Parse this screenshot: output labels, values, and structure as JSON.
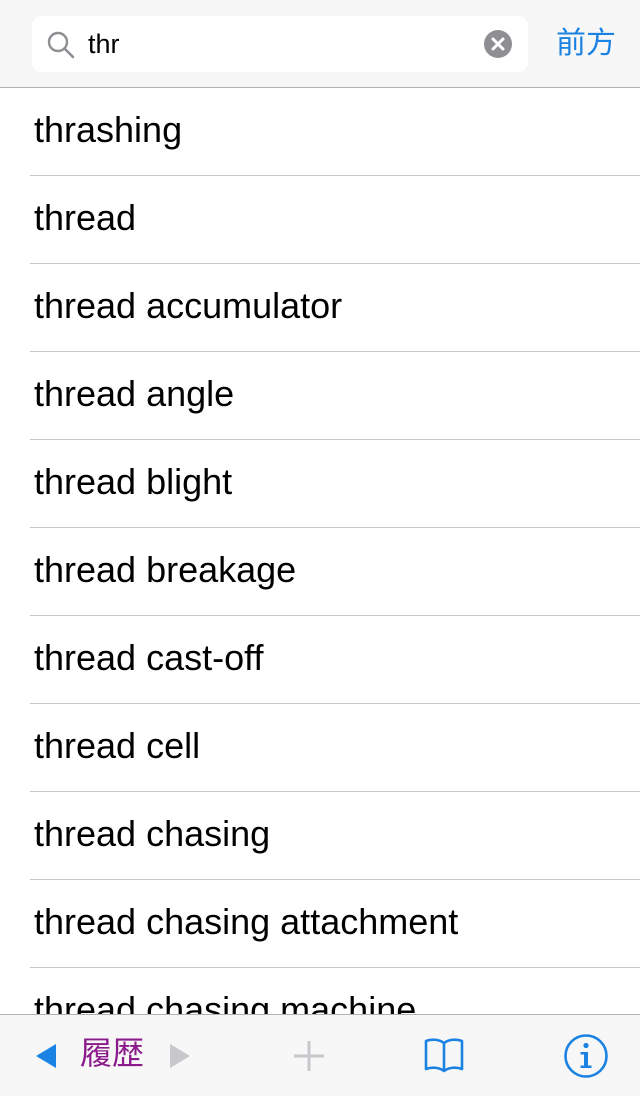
{
  "search": {
    "query": "thr",
    "forward_label": "前方"
  },
  "results": [
    "thrashing",
    "thread",
    "thread accumulator",
    "thread angle",
    "thread blight",
    "thread breakage",
    "thread cast-off",
    "thread cell",
    "thread chasing",
    "thread chasing attachment",
    "thread chasing machine"
  ],
  "toolbar": {
    "history_label": "履歴"
  },
  "colors": {
    "accent": "#1a82e2",
    "history": "#8b1a8b",
    "disabled": "#c7c7cc",
    "separator": "#c8c7cc"
  }
}
